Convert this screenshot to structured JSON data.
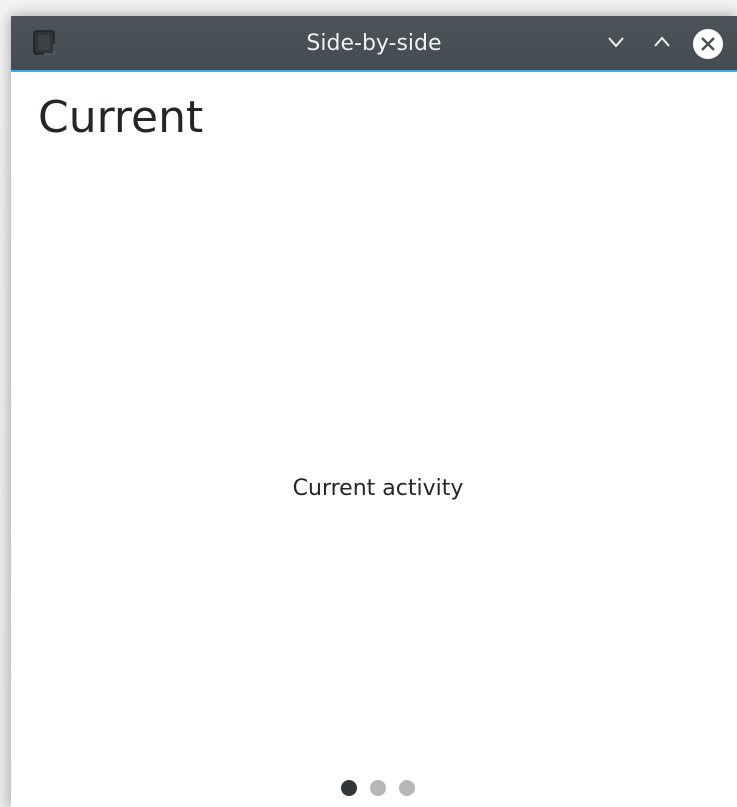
{
  "window": {
    "title": "Side-by-side",
    "icons": {
      "app": "app-window-icon",
      "minimize": "chevron-down-icon",
      "maximize": "chevron-up-icon",
      "close": "close-circle-icon"
    }
  },
  "page": {
    "heading": "Current",
    "body_text": "Current activity"
  },
  "pager": {
    "count": 3,
    "active_index": 0
  },
  "colors": {
    "titlebar": "#4a5156",
    "accent": "#3daee9",
    "text": "#232629",
    "dot_active": "#31363b",
    "dot_inactive": "#b5b7b8"
  }
}
